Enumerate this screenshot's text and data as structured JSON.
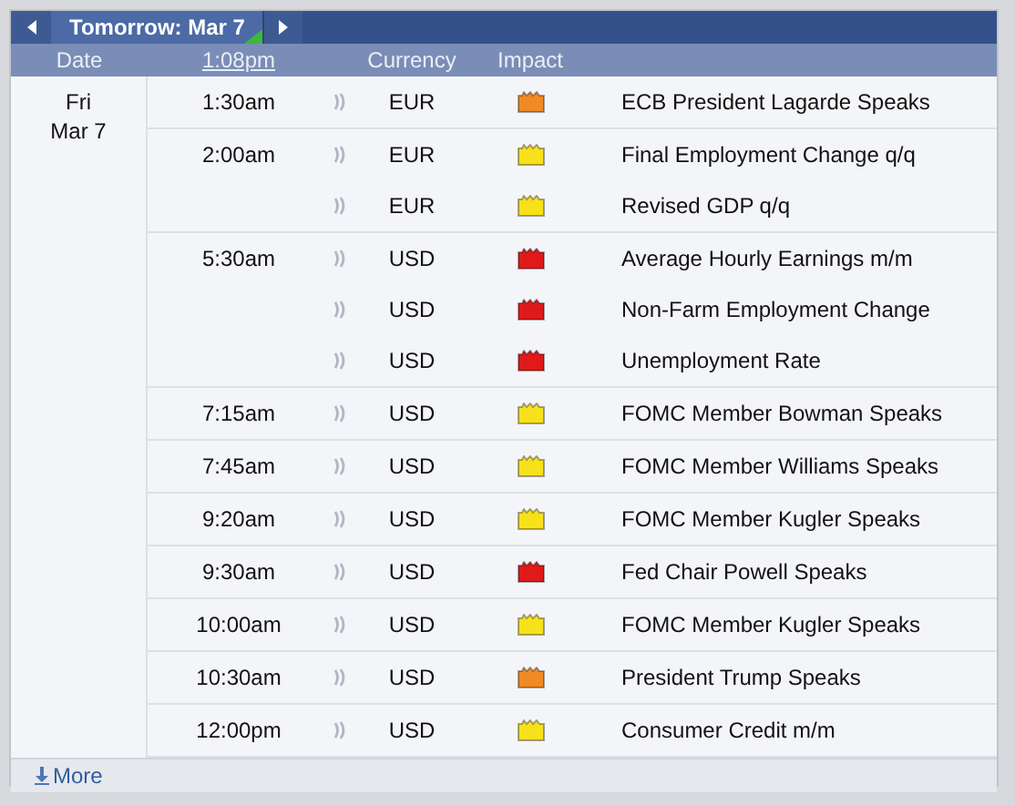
{
  "tab": {
    "label": "Tomorrow: Mar 7"
  },
  "columns": {
    "date": "Date",
    "time": "1:08pm",
    "currency": "Currency",
    "impact": "Impact"
  },
  "day": {
    "weekday": "Fri",
    "date": "Mar 7"
  },
  "groups": [
    {
      "time": "1:30am",
      "events": [
        {
          "currency": "EUR",
          "color": "#f08a24",
          "title": "ECB President Lagarde Speaks"
        }
      ]
    },
    {
      "time": "2:00am",
      "events": [
        {
          "currency": "EUR",
          "color": "#f7e11a",
          "title": "Final Employment Change q/q"
        },
        {
          "currency": "EUR",
          "color": "#f7e11a",
          "title": "Revised GDP q/q"
        }
      ]
    },
    {
      "time": "5:30am",
      "events": [
        {
          "currency": "USD",
          "color": "#e01a1a",
          "title": "Average Hourly Earnings m/m"
        },
        {
          "currency": "USD",
          "color": "#e01a1a",
          "title": "Non-Farm Employment Change"
        },
        {
          "currency": "USD",
          "color": "#e01a1a",
          "title": "Unemployment Rate"
        }
      ]
    },
    {
      "time": "7:15am",
      "events": [
        {
          "currency": "USD",
          "color": "#f7e11a",
          "title": "FOMC Member Bowman Speaks"
        }
      ]
    },
    {
      "time": "7:45am",
      "events": [
        {
          "currency": "USD",
          "color": "#f7e11a",
          "title": "FOMC Member Williams Speaks"
        }
      ]
    },
    {
      "time": "9:20am",
      "events": [
        {
          "currency": "USD",
          "color": "#f7e11a",
          "title": "FOMC Member Kugler Speaks"
        }
      ]
    },
    {
      "time": "9:30am",
      "events": [
        {
          "currency": "USD",
          "color": "#e01a1a",
          "title": "Fed Chair Powell Speaks"
        }
      ]
    },
    {
      "time": "10:00am",
      "events": [
        {
          "currency": "USD",
          "color": "#f7e11a",
          "title": "FOMC Member Kugler Speaks"
        }
      ]
    },
    {
      "time": "10:30am",
      "events": [
        {
          "currency": "USD",
          "color": "#f08a24",
          "title": "President Trump Speaks"
        }
      ]
    },
    {
      "time": "12:00pm",
      "events": [
        {
          "currency": "USD",
          "color": "#f7e11a",
          "title": "Consumer Credit m/m"
        }
      ]
    }
  ],
  "more": "More"
}
